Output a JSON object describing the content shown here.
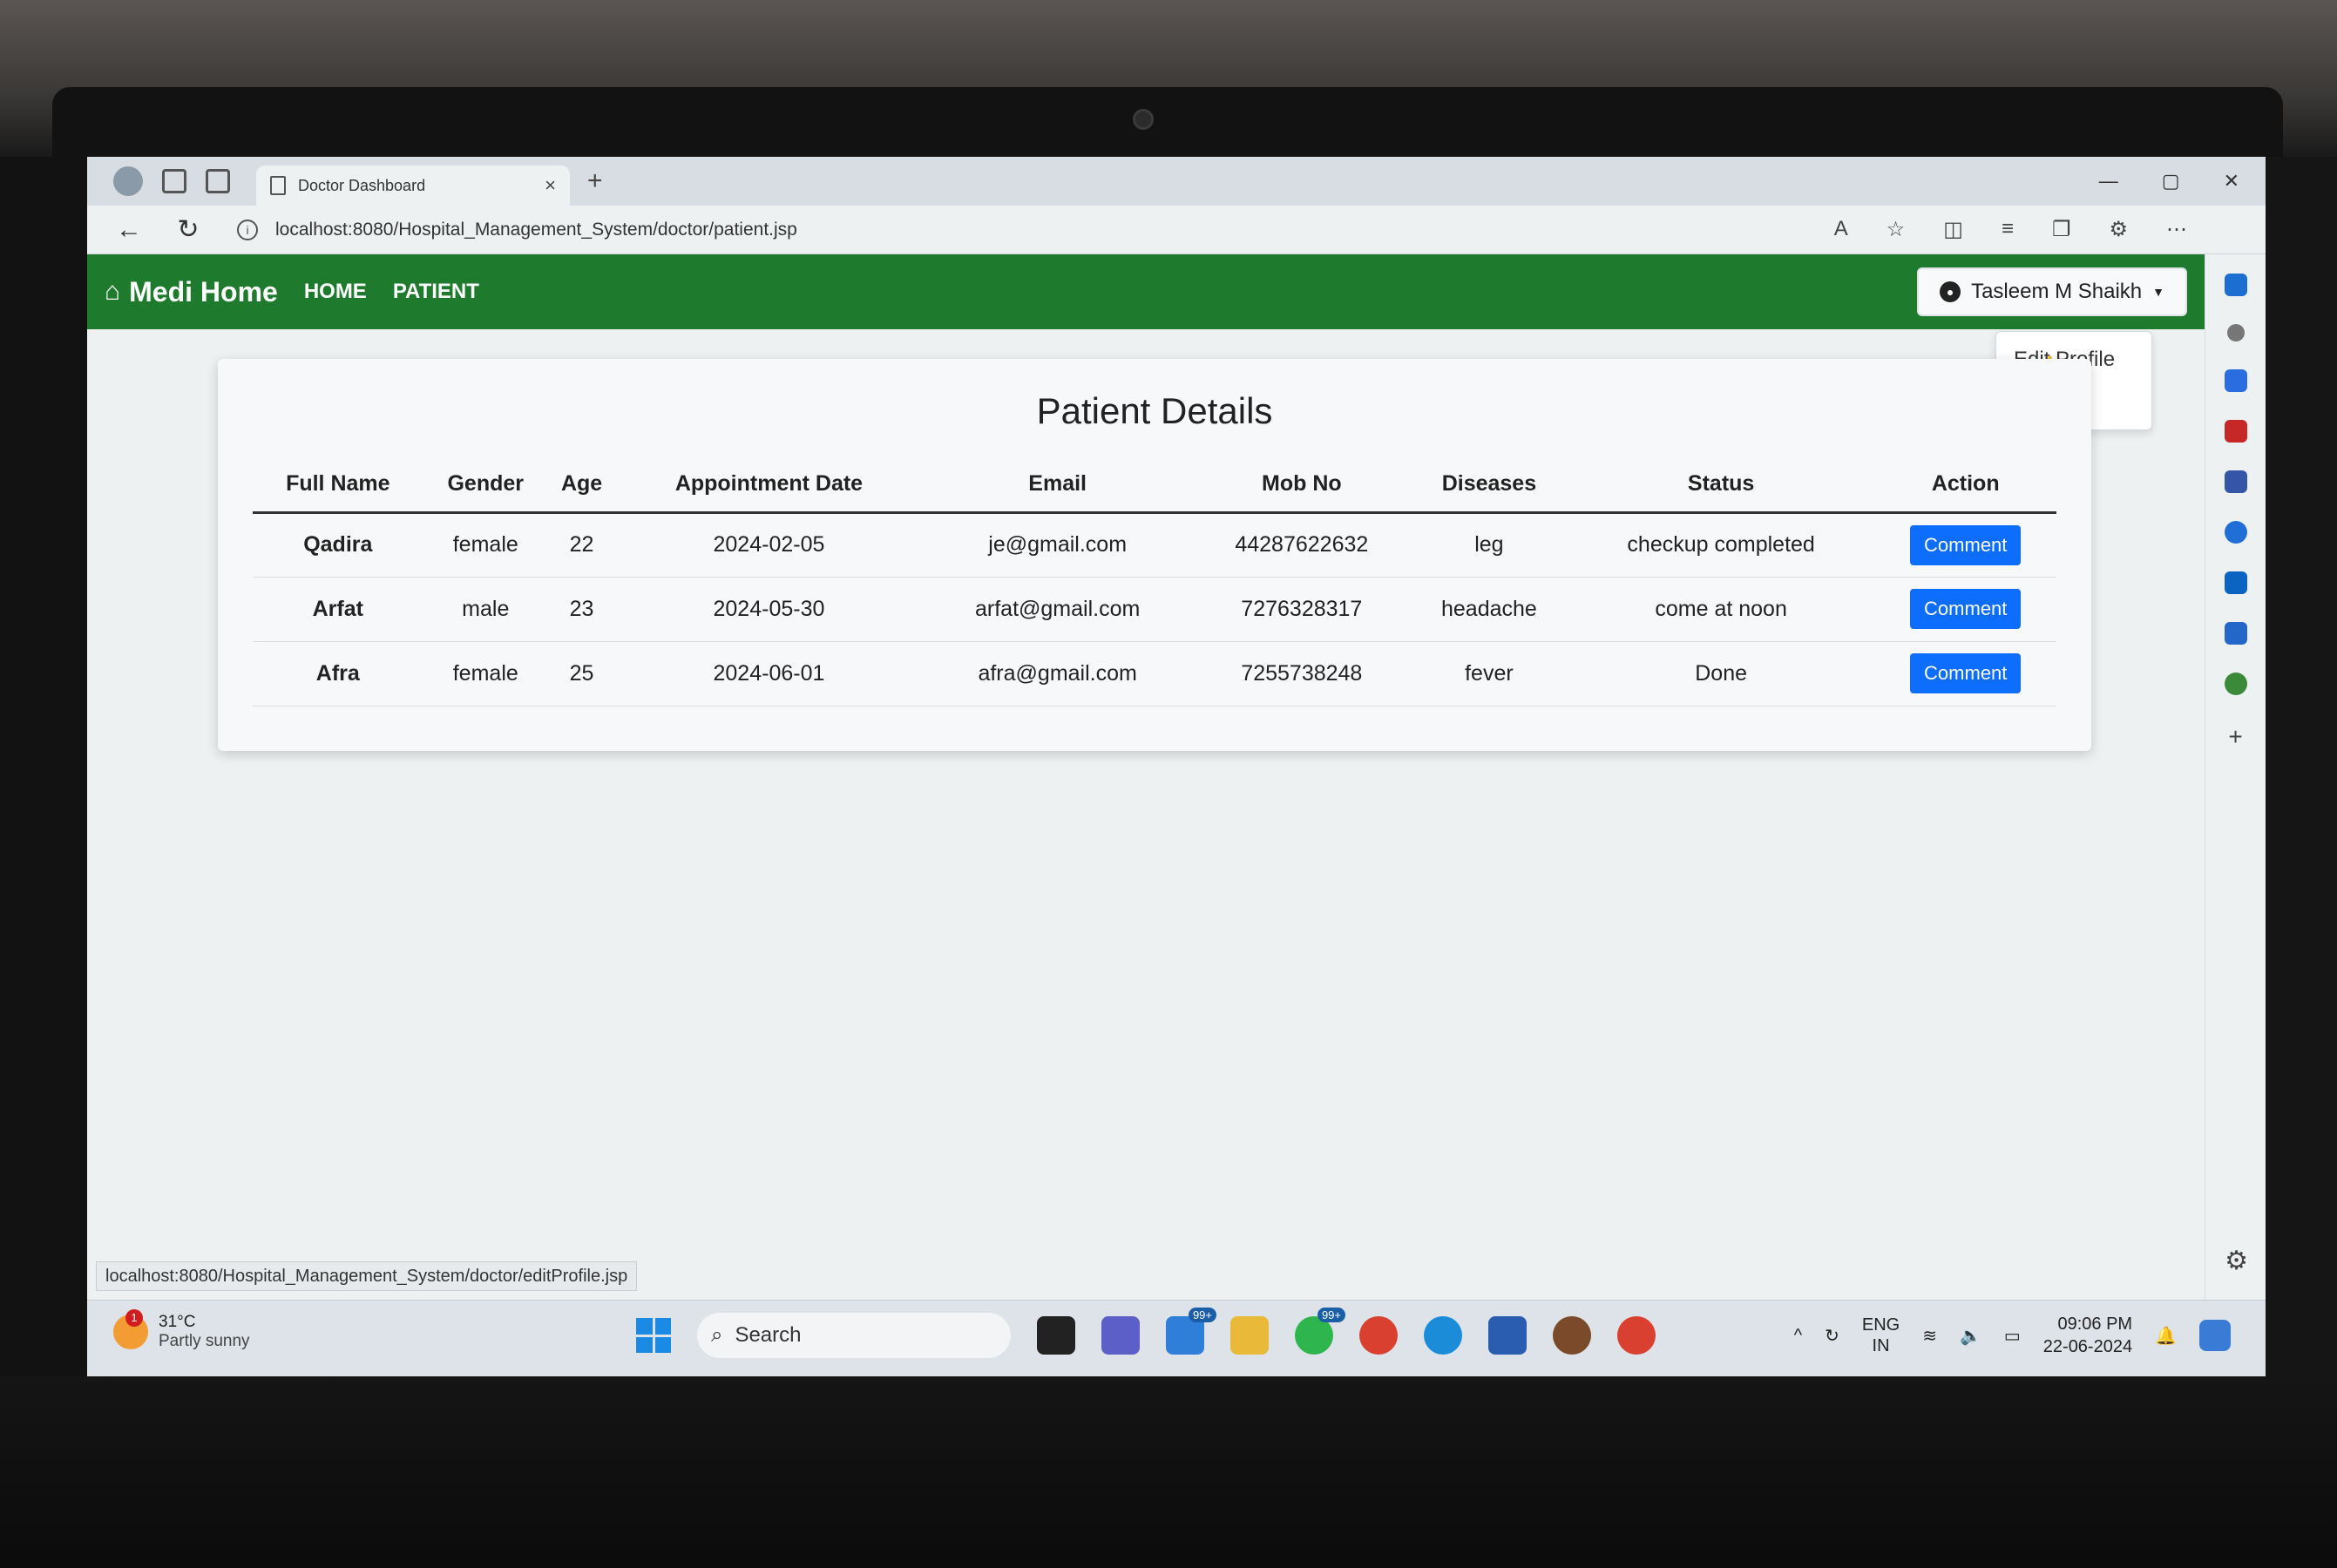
{
  "browser": {
    "tab_title": "Doctor Dashboard",
    "tab_close": "×",
    "tab_add": "+",
    "url": "localhost:8080/Hospital_Management_System/doctor/patient.jsp",
    "window_controls": [
      "—",
      "▢",
      "✕"
    ],
    "status_url": "localhost:8080/Hospital_Management_System/doctor/editProfile.jsp"
  },
  "navbar": {
    "brand": "Medi Home",
    "links": [
      "HOME",
      "PATIENT"
    ],
    "user_name": "Tasleem M Shaikh",
    "color": "#1e7a2c"
  },
  "dropdown": {
    "items": [
      "Edit Profile",
      "gout"
    ]
  },
  "card": {
    "title": "Patient Details",
    "headers": [
      "Full Name",
      "Gender",
      "Age",
      "Appointment Date",
      "Email",
      "Mob No",
      "Diseases",
      "Status",
      "Action"
    ],
    "rows": [
      [
        "Qadira",
        "female",
        "22",
        "2024-02-05",
        "je@gmail.com",
        "44287622632",
        "leg",
        "checkup completed",
        "Comment"
      ],
      [
        "Arfat",
        "male",
        "23",
        "2024-05-30",
        "arfat@gmail.com",
        "7276328317",
        "headache",
        "come at noon",
        "Comment"
      ],
      [
        "Afra",
        "female",
        "25",
        "2024-06-01",
        "afra@gmail.com",
        "7255738248",
        "fever",
        "Done",
        "Comment"
      ]
    ]
  },
  "taskbar": {
    "weather_temp": "31°C",
    "weather_desc": "Partly sunny",
    "weather_badge": "1",
    "search_placeholder": "Search",
    "mail_badge": "99+",
    "whatsapp_badge": "99+",
    "lang_top": "ENG",
    "lang_bottom": "IN",
    "time": "09:06 PM",
    "date": "22-06-2024"
  },
  "colors": {
    "accent_button": "#0d6efd",
    "navbar_green": "#1e7a2c"
  }
}
